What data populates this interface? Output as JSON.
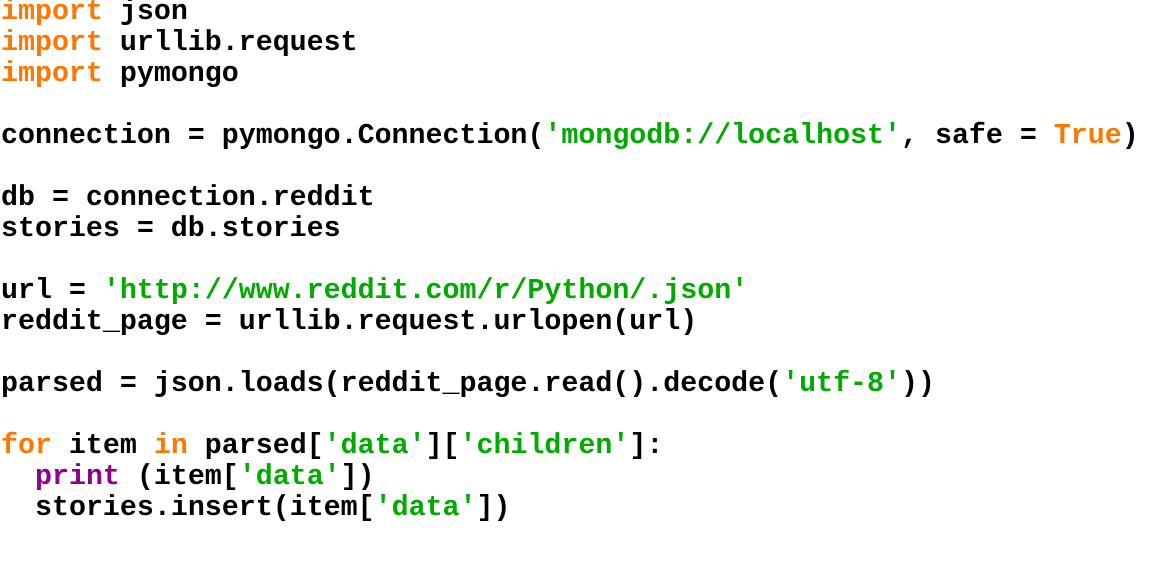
{
  "code_lines": [
    {
      "indent": false,
      "tokens": [
        {
          "t": "kw",
          "v": "import"
        },
        {
          "t": "txt",
          "v": " json"
        }
      ]
    },
    {
      "indent": false,
      "tokens": [
        {
          "t": "kw",
          "v": "import"
        },
        {
          "t": "txt",
          "v": " urllib.request"
        }
      ]
    },
    {
      "indent": false,
      "tokens": [
        {
          "t": "kw",
          "v": "import"
        },
        {
          "t": "txt",
          "v": " pymongo"
        }
      ]
    },
    {
      "indent": false,
      "tokens": []
    },
    {
      "indent": false,
      "tokens": [
        {
          "t": "txt",
          "v": "connection = pymongo.Connection("
        },
        {
          "t": "str",
          "v": "'mongodb://localhost'"
        },
        {
          "t": "txt",
          "v": ", safe = "
        },
        {
          "t": "kw",
          "v": "True"
        },
        {
          "t": "txt",
          "v": ")"
        }
      ]
    },
    {
      "indent": false,
      "tokens": []
    },
    {
      "indent": false,
      "tokens": [
        {
          "t": "txt",
          "v": "db = connection.reddit"
        }
      ]
    },
    {
      "indent": false,
      "tokens": [
        {
          "t": "txt",
          "v": "stories = db.stories"
        }
      ]
    },
    {
      "indent": false,
      "tokens": []
    },
    {
      "indent": false,
      "tokens": [
        {
          "t": "txt",
          "v": "url = "
        },
        {
          "t": "str",
          "v": "'http://www.reddit.com/r/Python/.json'"
        }
      ]
    },
    {
      "indent": false,
      "tokens": [
        {
          "t": "txt",
          "v": "reddit_page = urllib.request.urlopen(url)"
        }
      ]
    },
    {
      "indent": false,
      "tokens": []
    },
    {
      "indent": false,
      "tokens": [
        {
          "t": "txt",
          "v": "parsed = json.loads(reddit_page.read().decode("
        },
        {
          "t": "str",
          "v": "'utf-8'"
        },
        {
          "t": "txt",
          "v": "))"
        }
      ]
    },
    {
      "indent": false,
      "tokens": []
    },
    {
      "indent": false,
      "tokens": [
        {
          "t": "kw",
          "v": "for"
        },
        {
          "t": "txt",
          "v": " item "
        },
        {
          "t": "kw",
          "v": "in"
        },
        {
          "t": "txt",
          "v": " parsed["
        },
        {
          "t": "str",
          "v": "'data'"
        },
        {
          "t": "txt",
          "v": "]["
        },
        {
          "t": "str",
          "v": "'children'"
        },
        {
          "t": "txt",
          "v": "]:"
        }
      ]
    },
    {
      "indent": true,
      "tokens": [
        {
          "t": "bi",
          "v": "print"
        },
        {
          "t": "txt",
          "v": " (item["
        },
        {
          "t": "str",
          "v": "'data'"
        },
        {
          "t": "txt",
          "v": "])"
        }
      ]
    },
    {
      "indent": true,
      "tokens": [
        {
          "t": "txt",
          "v": "stories.insert(item["
        },
        {
          "t": "str",
          "v": "'data'"
        },
        {
          "t": "txt",
          "v": "])"
        }
      ]
    }
  ],
  "colors": {
    "keyword": "#ff7700",
    "string": "#00aa00",
    "builtin": "#900090",
    "text": "#000000",
    "background": "#ffffff"
  }
}
